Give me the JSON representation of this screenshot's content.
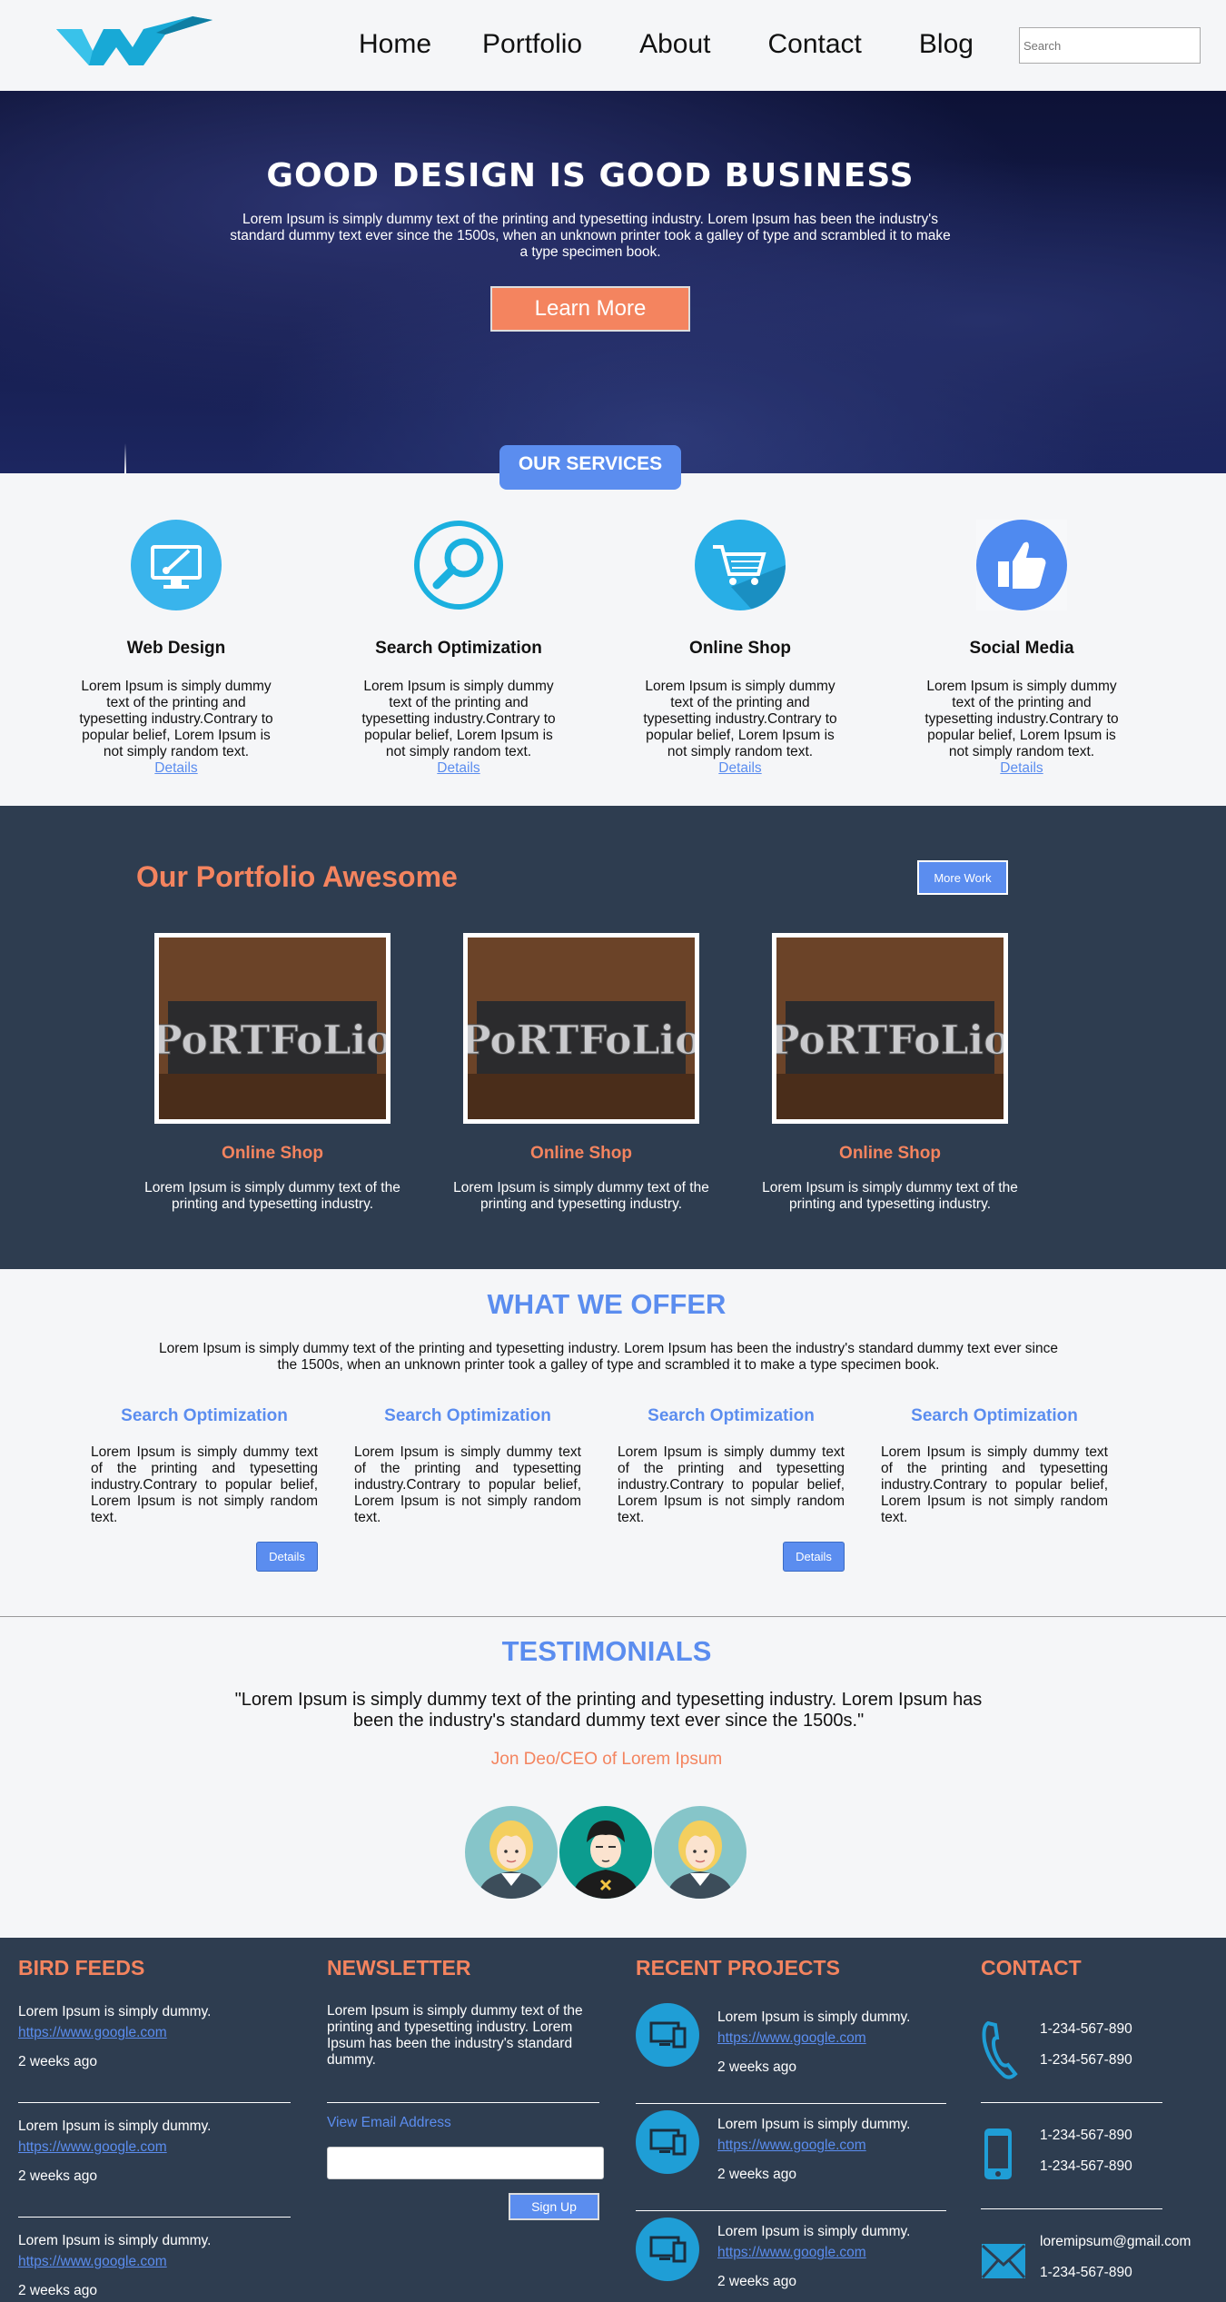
{
  "colors": {
    "accent": "#5b8def",
    "orange": "#f4845f",
    "dark": "#2e3d50",
    "cyan": "#1f9ed6"
  },
  "header": {
    "logo": "logo-w-icon",
    "nav": [
      "Home",
      "Portfolio",
      "About",
      "Contact",
      "Blog"
    ],
    "search_placeholder": "Search"
  },
  "hero": {
    "title": "GOOD DESIGN IS GOOD BUSINESS",
    "text": "Lorem Ipsum is simply dummy text of the printing and typesetting industry. Lorem Ipsum has been the industry's standard dummy text ever since the 1500s, when an unknown printer took a galley of type and scrambled it to make a type specimen book.",
    "button": "Learn More"
  },
  "services": {
    "tab": "OUR SERVICES",
    "items": [
      {
        "icon": "brush-monitor-icon",
        "title": "Web Design",
        "text": "Lorem Ipsum is simply dummy text of the printing and typesetting industry.Contrary to popular belief, Lorem Ipsum is not simply random text.",
        "link": "Details"
      },
      {
        "icon": "magnifier-icon",
        "title": "Search Optimization",
        "text": "Lorem Ipsum is simply dummy text of the printing and typesetting industry.Contrary to popular belief, Lorem Ipsum is not simply random text.",
        "link": "Details"
      },
      {
        "icon": "shopping-cart-icon",
        "title": "Online Shop",
        "text": "Lorem Ipsum is simply dummy text of the printing and typesetting industry.Contrary to popular belief, Lorem Ipsum is not simply random text.",
        "link": "Details"
      },
      {
        "icon": "thumbs-up-icon",
        "title": "Social Media",
        "text": "Lorem Ipsum is simply dummy text of the printing and typesetting industry.Contrary to popular belief, Lorem Ipsum is not simply random text.",
        "link": "Details"
      }
    ]
  },
  "portfolio": {
    "title": "Our Portfolio Awesome",
    "button": "More Work",
    "items": [
      {
        "image_word": "PoRTFoLio",
        "name": "Online Shop",
        "text": "Lorem Ipsum is simply dummy text of the printing and typesetting industry."
      },
      {
        "image_word": "PoRTFoLio",
        "name": "Online Shop",
        "text": "Lorem Ipsum is simply dummy text of the printing and typesetting industry."
      },
      {
        "image_word": "PoRTFoLio",
        "name": "Online Shop",
        "text": "Lorem Ipsum is simply dummy text of the printing and typesetting industry."
      }
    ]
  },
  "offer": {
    "title": "WHAT WE OFFER",
    "text": "Lorem Ipsum is simply dummy text of the printing and typesetting industry. Lorem Ipsum has been the industry's standard dummy text ever since the 1500s, when an unknown printer took a galley of type and scrambled it to make a type specimen book.",
    "items": [
      {
        "title": "Search Optimization",
        "text": "Lorem Ipsum is simply dummy text of the printing and typesetting industry.Contrary to popular belief, Lorem Ipsum is not simply random text.",
        "button": "Details"
      },
      {
        "title": "Search Optimization",
        "text": "Lorem Ipsum is simply dummy text of the printing and typesetting industry.Contrary to popular belief, Lorem Ipsum is not simply random text."
      },
      {
        "title": "Search Optimization",
        "text": "Lorem Ipsum is simply dummy text of the printing and typesetting industry.Contrary to popular belief, Lorem Ipsum is not simply random text.",
        "button": "Details"
      },
      {
        "title": "Search Optimization",
        "text": "Lorem Ipsum is simply dummy text of the printing and typesetting industry.Contrary to popular belief, Lorem Ipsum is not simply random text."
      }
    ]
  },
  "testimonials": {
    "title": "TESTIMONIALS",
    "quote": "\"Lorem Ipsum is simply dummy text of the printing and typesetting industry. Lorem Ipsum has been the industry's standard dummy text ever since the 1500s.\"",
    "author": "Jon Deo/CEO of Lorem Ipsum",
    "avatars": [
      "blonde-woman-avatar-icon",
      "dark-hair-man-avatar-icon",
      "blonde-woman-avatar-icon"
    ]
  },
  "footer": {
    "bird_feeds": {
      "title": "BIRD FEEDS",
      "items": [
        {
          "text": "Lorem Ipsum is simply dummy.",
          "link": "https://www.google.com",
          "ago": "2 weeks ago"
        },
        {
          "text": "Lorem Ipsum is simply dummy.",
          "link": "https://www.google.com",
          "ago": "2 weeks ago"
        },
        {
          "text": "Lorem Ipsum is simply dummy.",
          "link": "https://www.google.com",
          "ago": "2 weeks ago"
        }
      ]
    },
    "newsletter": {
      "title": "NEWSLETTER",
      "text": "Lorem Ipsum is simply dummy text of the printing and typesetting industry. Lorem Ipsum has been the industry's standard dummy.",
      "email_label": "View Email Address",
      "button": "Sign Up"
    },
    "projects": {
      "title": "RECENT PROJECTS",
      "icon": "devices-icon",
      "items": [
        {
          "text": "Lorem Ipsum is simply dummy.",
          "link": "https://www.google.com",
          "ago": "2 weeks ago"
        },
        {
          "text": "Lorem Ipsum is simply dummy.",
          "link": "https://www.google.com",
          "ago": "2 weeks ago"
        },
        {
          "text": "Lorem Ipsum is simply dummy.",
          "link": "https://www.google.com",
          "ago": "2 weeks ago"
        }
      ]
    },
    "contact": {
      "title": "CONTACT",
      "phone_icon": "phone-handset-icon",
      "mobile_icon": "mobile-phone-icon",
      "mail_icon": "envelope-icon",
      "phones": [
        "1-234-567-890",
        "1-234-567-890"
      ],
      "mobiles": [
        "1-234-567-890",
        "1-234-567-890"
      ],
      "email": "loremipsum@gmail.com",
      "email_phone": "1-234-567-890"
    }
  }
}
